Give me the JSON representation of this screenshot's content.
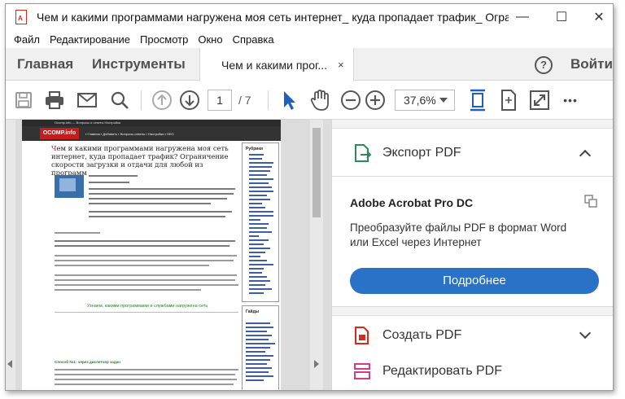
{
  "window": {
    "title": "Чем и какими программами нагружена моя сеть интернет_ куда пропадает трафик_ Ограничение с...",
    "minimize": "—",
    "maximize": "☐",
    "close": "✕"
  },
  "menu": [
    "Файл",
    "Редактирование",
    "Просмотр",
    "Окно",
    "Справка"
  ],
  "tabs": {
    "home": "Главная",
    "tools": "Инструменты",
    "document": "Чем и какими прог...",
    "document_close": "×",
    "help": "?",
    "signin": "Войти"
  },
  "toolbar": {
    "page_current": "1",
    "page_total": "/ 7",
    "zoom": "37,6%",
    "more": "•••"
  },
  "document_page": {
    "site_top": "Ocomp.info — Вопросы и ответы     Настройки",
    "logo": "OCOMP.info",
    "nav": "▪ Главная   ▪ Добавить   ▪ Вопросы-ответы   ▪ Настройки   ▪ SEO",
    "title_first": "Ч",
    "title_rest": "ем и какими программами нагружена моя сеть интернет, куда пропадает трафик? Ограничение скорости загрузки и отдачи для любой из программ",
    "green_link": "Узнаем, какими программами и службами нагружена сеть",
    "green_head": "Способ №1: через диспетчер задач",
    "rubric_title": "Рубрики",
    "guides_title": "Гайды"
  },
  "panel": {
    "export_label": "Экспорт PDF",
    "promo_title": "Adobe Acrobat Pro DC",
    "promo_desc": "Преобразуйте файлы PDF в формат Word или Excel через Интернет",
    "promo_button": "Подробнее",
    "create_label": "Создать PDF",
    "edit_label": "Редактировать PDF"
  },
  "colors": {
    "accent_blue": "#2a72c7",
    "export_green": "#2e8b57",
    "create_red": "#d8291d",
    "edit_pink": "#d43c8a",
    "cursor_blue": "#1f5fbf"
  }
}
